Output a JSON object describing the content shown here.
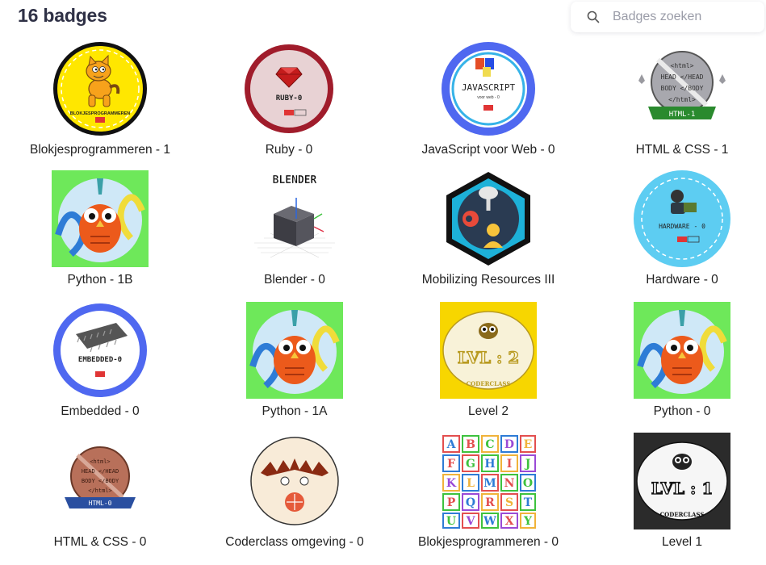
{
  "header": {
    "title": "16 badges"
  },
  "search": {
    "placeholder": "Badges zoeken",
    "value": ""
  },
  "icons": {
    "search": "search-icon"
  },
  "badges": [
    {
      "name": "Blokjesprogrammeren - 1",
      "icon": "scratch-cat-badge",
      "text": "BLOKJESPROGRAMMEREN"
    },
    {
      "name": "Ruby - 0",
      "icon": "ruby-gem-badge",
      "text": "RUBY-0"
    },
    {
      "name": "JavaScript voor Web - 0",
      "icon": "javascript-badge",
      "text": "JAVASCRIPT",
      "sub": "voor web - 0"
    },
    {
      "name": "HTML & CSS - 1",
      "icon": "html-css-badge",
      "text": "HTML-1"
    },
    {
      "name": "Python - 1B",
      "icon": "python-owl-badge"
    },
    {
      "name": "Blender - 0",
      "icon": "blender-cube-badge",
      "text": "BLENDER"
    },
    {
      "name": "Mobilizing Resources III",
      "icon": "hexagon-badge"
    },
    {
      "name": "Hardware - 0",
      "icon": "hardware-badge",
      "text": "HARDWARE - 0"
    },
    {
      "name": "Embedded - 0",
      "icon": "embedded-chip-badge",
      "text": "EMBEDDED-0"
    },
    {
      "name": "Python - 1A",
      "icon": "python-owl-badge"
    },
    {
      "name": "Level 2",
      "icon": "level-owl-badge",
      "text": "LVL : 2",
      "sub": "CODERCLASS"
    },
    {
      "name": "Python - 0",
      "icon": "python-owl-badge"
    },
    {
      "name": "HTML & CSS - 0",
      "icon": "html-css-badge",
      "text": "HTML-0"
    },
    {
      "name": "Coderclass omgeving - 0",
      "icon": "coderclass-badge"
    },
    {
      "name": "Blokjesprogrammeren - 0",
      "icon": "alphabet-blocks-badge"
    },
    {
      "name": "Level 1",
      "icon": "level-owl-badge",
      "text": "LVL : 1",
      "sub": "CODERCLASS"
    }
  ],
  "colors": {
    "title": "#2f3146",
    "scratch_yellow": "#ffe700",
    "ruby_red": "#a01c2b",
    "js_blue": "#4f68f0",
    "python_green": "#6ee85a",
    "level_yellow": "#f7d600",
    "level1_dark": "#2b2b2b"
  }
}
